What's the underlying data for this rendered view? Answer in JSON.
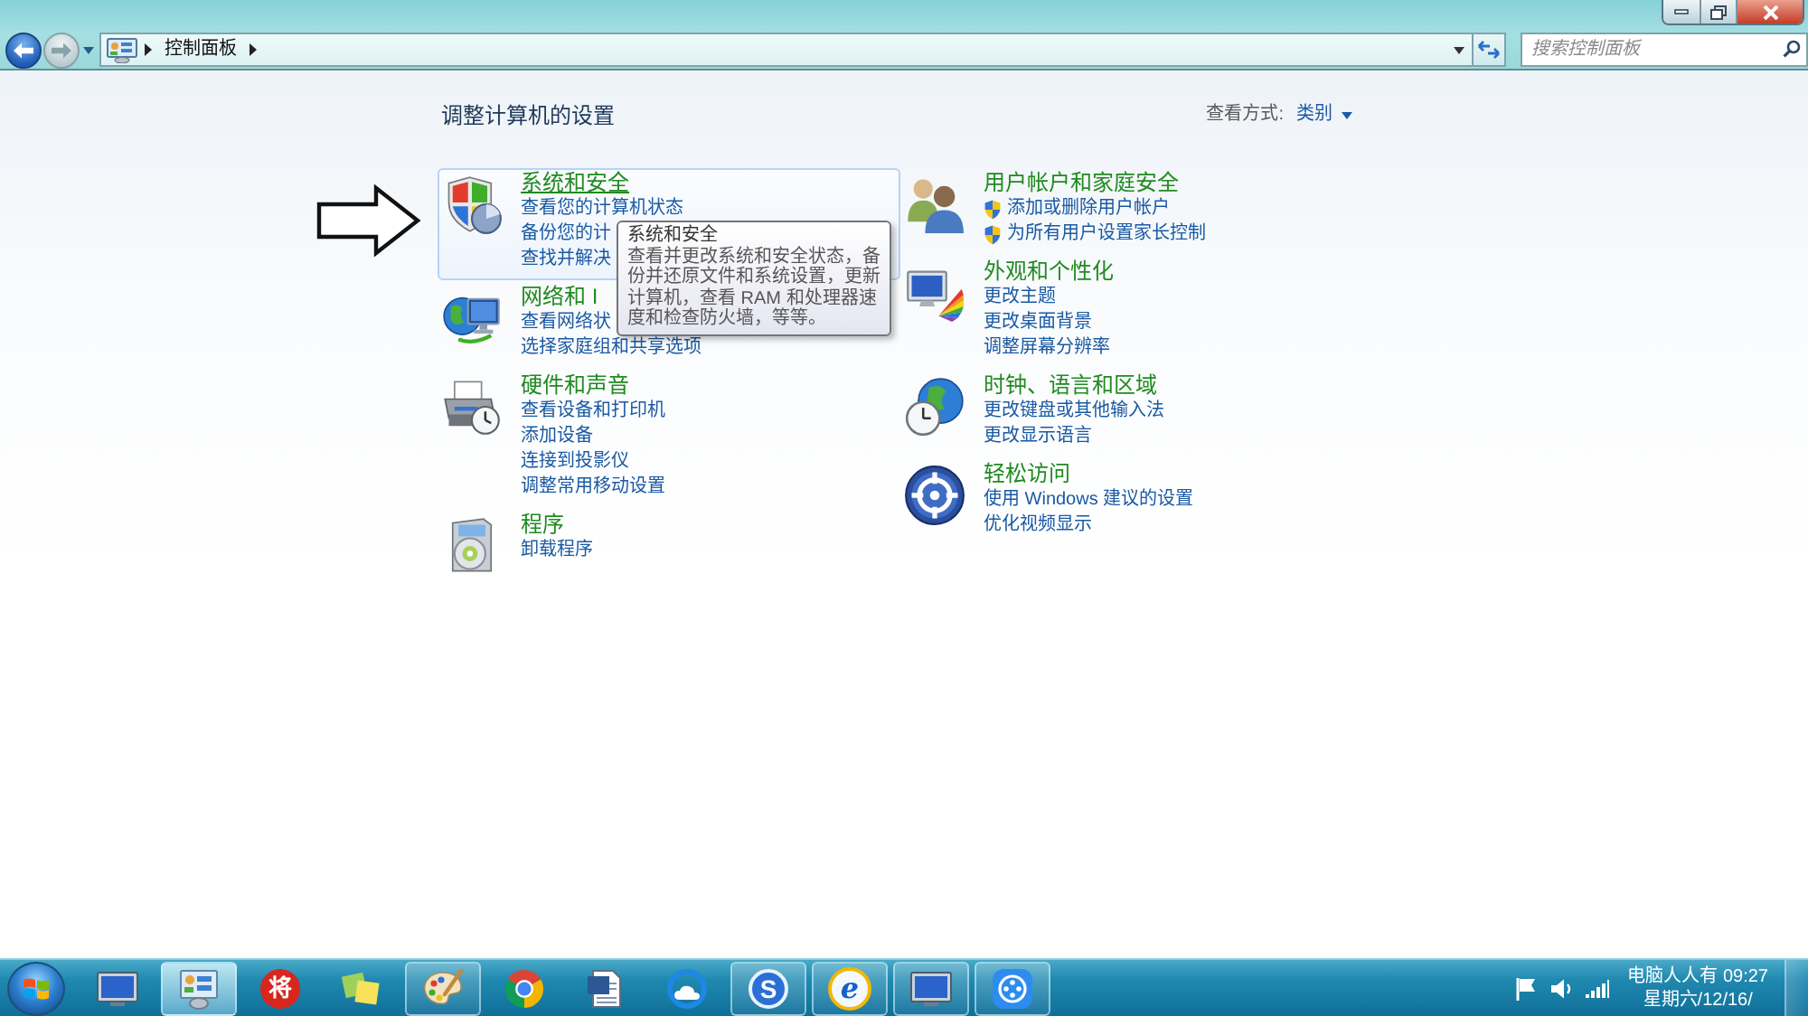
{
  "navigation": {
    "breadcrumb": [
      {
        "label": "控制面板"
      }
    ],
    "search": {
      "placeholder": "搜索控制面板"
    }
  },
  "header": {
    "title": "调整计算机的设置",
    "view_by": {
      "label": "查看方式:",
      "value": "类别"
    }
  },
  "columns": [
    {
      "categories": [
        {
          "kind": "shield",
          "title": "系统和安全",
          "hovered": true,
          "links": [
            {
              "label": "查看您的计算机状态",
              "uac_shield": false
            },
            {
              "label": "备份您的计",
              "uac_shield": false
            },
            {
              "label": "查找并解决",
              "uac_shield": false
            }
          ]
        },
        {
          "kind": "network",
          "title": "网络和 I",
          "hovered": false,
          "links": [
            {
              "label": "查看网络状",
              "uac_shield": false
            },
            {
              "label": "选择家庭组和共享选项",
              "uac_shield": false
            }
          ]
        },
        {
          "kind": "printer",
          "title": "硬件和声音",
          "hovered": false,
          "links": [
            {
              "label": "查看设备和打印机",
              "uac_shield": false
            },
            {
              "label": "添加设备",
              "uac_shield": false
            },
            {
              "label": "连接到投影仪",
              "uac_shield": false
            },
            {
              "label": "调整常用移动设置",
              "uac_shield": false
            }
          ]
        },
        {
          "kind": "programs",
          "title": "程序",
          "hovered": false,
          "links": [
            {
              "label": "卸载程序",
              "uac_shield": false
            }
          ]
        }
      ]
    },
    {
      "categories": [
        {
          "kind": "users",
          "title": "用户帐户和家庭安全",
          "hovered": false,
          "links": [
            {
              "label": "添加或删除用户帐户",
              "uac_shield": true
            },
            {
              "label": "为所有用户设置家长控制",
              "uac_shield": true
            }
          ]
        },
        {
          "kind": "display",
          "title": "外观和个性化",
          "hovered": false,
          "links": [
            {
              "label": "更改主题",
              "uac_shield": false
            },
            {
              "label": "更改桌面背景",
              "uac_shield": false
            },
            {
              "label": "调整屏幕分辨率",
              "uac_shield": false
            }
          ]
        },
        {
          "kind": "clock",
          "title": "时钟、语言和区域",
          "hovered": false,
          "links": [
            {
              "label": "更改键盘或其他输入法",
              "uac_shield": false
            },
            {
              "label": "更改显示语言",
              "uac_shield": false
            }
          ]
        },
        {
          "kind": "access",
          "title": "轻松访问",
          "hovered": false,
          "links": [
            {
              "label": "使用 Windows 建议的设置",
              "uac_shield": false
            },
            {
              "label": "优化视频显示",
              "uac_shield": false
            }
          ]
        }
      ]
    }
  ],
  "tooltip": {
    "title": "系统和安全",
    "text": "查看并更改系统和安全状态，备份并还原文件和系统设置，更新计算机，查看 RAM 和处理器速度和检查防火墙，等等。"
  },
  "taskbar": {
    "apps": [
      {
        "kind": "screen",
        "running": false,
        "selected": false
      },
      {
        "kind": "panel",
        "running": true,
        "selected": true
      },
      {
        "kind": "seal",
        "glyph": "将",
        "running": false,
        "selected": false
      },
      {
        "kind": "notes",
        "running": false,
        "selected": false
      },
      {
        "kind": "palette",
        "running": true,
        "selected": false
      },
      {
        "kind": "sphere",
        "running": false,
        "selected": false
      },
      {
        "kind": "document",
        "running": false,
        "selected": false
      },
      {
        "kind": "cloud",
        "running": false,
        "selected": false
      },
      {
        "kind": "disc",
        "glyph": "S",
        "running": true,
        "selected": false
      },
      {
        "kind": "orbit",
        "glyph": "e",
        "running": true,
        "selected": false
      },
      {
        "kind": "screen",
        "running": true,
        "selected": false
      },
      {
        "kind": "reel",
        "running": true,
        "selected": false
      }
    ],
    "clock": {
      "time": "电脑人人有 09:27",
      "date": "星期六/12/16/"
    }
  }
}
